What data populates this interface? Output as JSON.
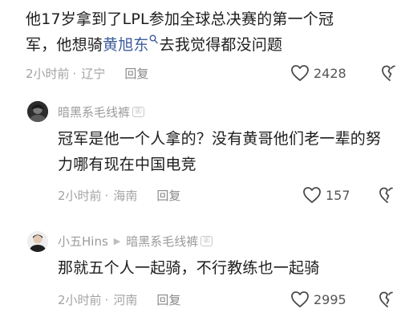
{
  "top_comment": {
    "text_before": "他17岁拿到了LPL参加全球总决赛的第一个冠军，他想骑",
    "mention": "黄旭东",
    "text_after": "去我觉得都没问题",
    "time": "2小时前",
    "location": "辽宁",
    "reply_label": "回复",
    "likes": "2428"
  },
  "replies": [
    {
      "username": "暗黑系毛线裤",
      "text": "冠军是他一个人拿的？没有黄哥他们老一辈的努力哪有现在中国电竞",
      "time": "2小时前",
      "location": "海南",
      "reply_label": "回复",
      "likes": "157"
    },
    {
      "username": "小五Hins",
      "reply_to": "暗黑系毛线裤",
      "text": "那就五个人一起骑，不行教练也一起骑",
      "time": "2小时前",
      "location": "河南",
      "reply_label": "回复",
      "likes": "2995"
    }
  ],
  "colors": {
    "mention": "#3c5c9c",
    "meta": "#a3a3a3",
    "text": "#1d1d1d"
  },
  "icons": {
    "like": "heart-outline-icon",
    "dislike": "broken-heart-icon",
    "mention": "search-icon"
  }
}
